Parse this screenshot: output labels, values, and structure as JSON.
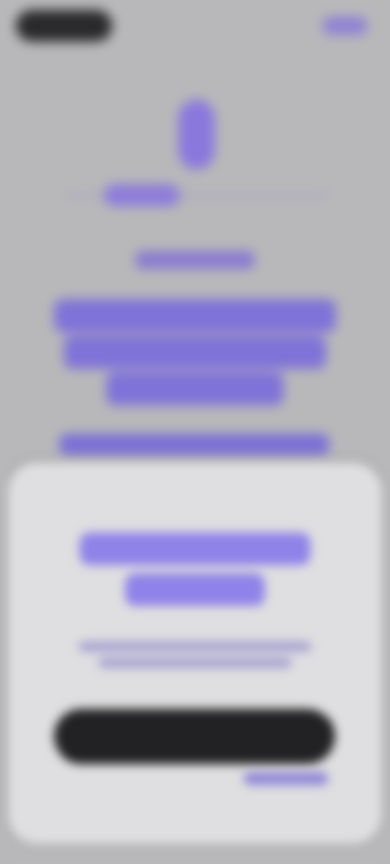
{
  "app": {
    "status_left": "",
    "status_right": ""
  },
  "hero": {
    "subheading": "",
    "headline": [
      "",
      "",
      ""
    ],
    "secondary_text": ""
  },
  "sheet": {
    "title": [
      "",
      ""
    ],
    "description": [
      "",
      ""
    ],
    "primary_button_label": "",
    "secondary_link_label": ""
  },
  "colors": {
    "accent": "#7f72d8",
    "dark": "#222224",
    "sheet_bg": "#dfdfe1",
    "screen_bg": "#b8b8ba"
  }
}
